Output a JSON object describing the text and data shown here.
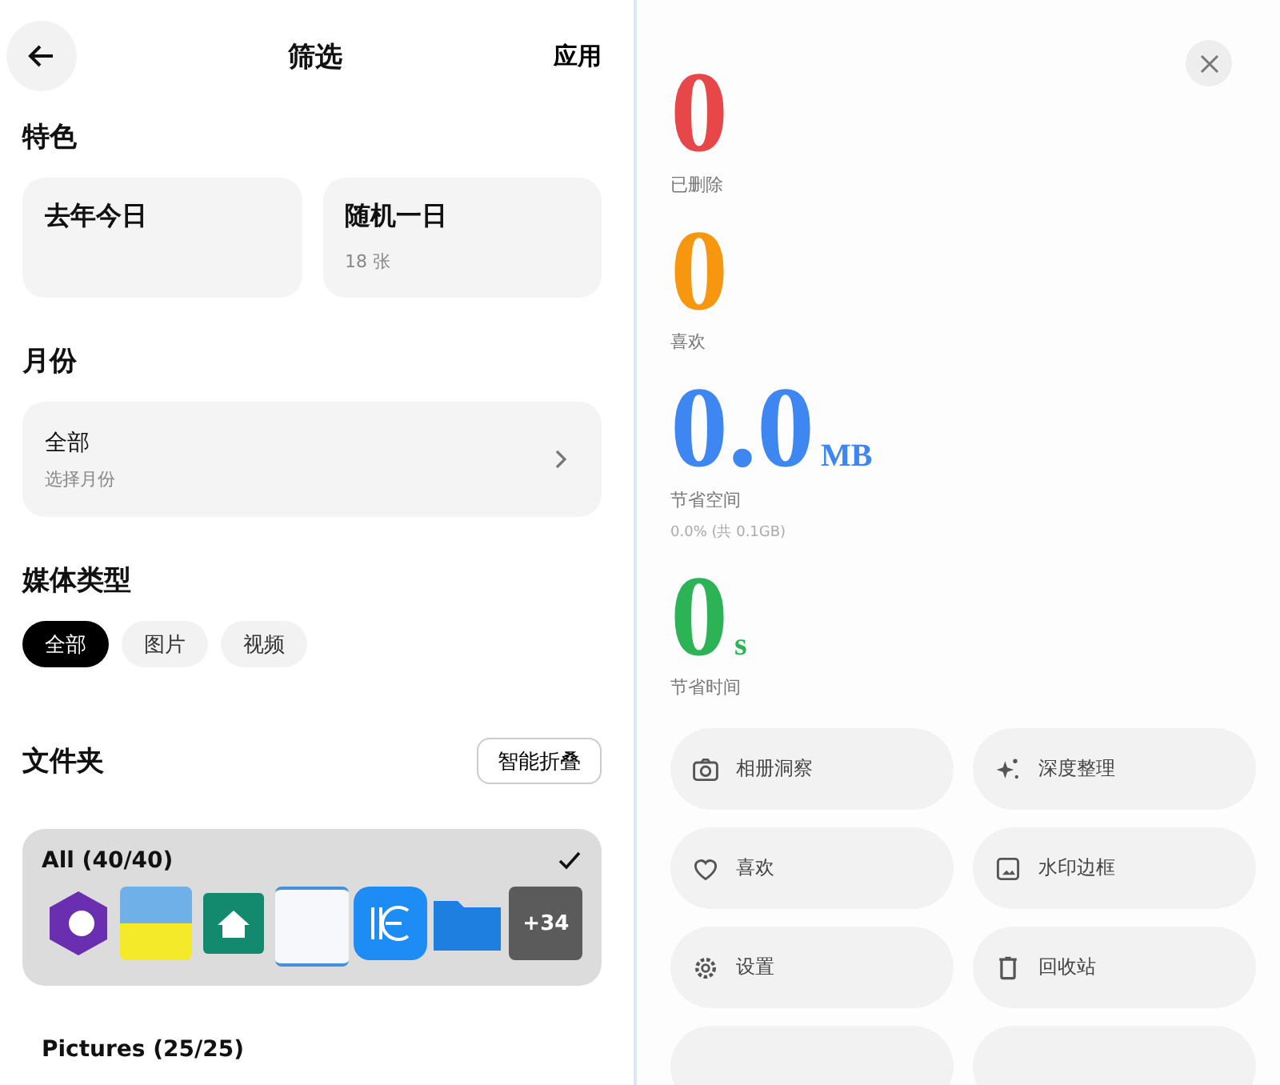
{
  "header": {
    "title": "筛选",
    "action": "应用"
  },
  "featured": {
    "heading": "特色",
    "cards": [
      {
        "title": "去年今日"
      },
      {
        "title": "随机一日",
        "subtitle": "18 张"
      }
    ]
  },
  "month": {
    "heading": "月份",
    "value": "全部",
    "hint": "选择月份"
  },
  "media": {
    "heading": "媒体类型",
    "chips": [
      {
        "label": "全部",
        "selected": true
      },
      {
        "label": "图片",
        "selected": false
      },
      {
        "label": "视频",
        "selected": false
      }
    ]
  },
  "folders": {
    "heading": "文件夹",
    "fold_button": "智能折叠",
    "items": [
      {
        "name": "All (40/40)",
        "selected": true,
        "thumbnails": [
          {
            "kind": "hexagon"
          },
          {
            "kind": "banner"
          },
          {
            "kind": "house"
          },
          {
            "kind": "document"
          },
          {
            "kind": "app"
          },
          {
            "kind": "folder"
          },
          {
            "kind": "more",
            "label": "+34"
          }
        ]
      },
      {
        "name": "Pictures (25/25)",
        "selected": false
      }
    ]
  },
  "stats": [
    {
      "value": "0",
      "label": "已删除",
      "color": "#e8474a"
    },
    {
      "value": "0",
      "label": "喜欢",
      "color": "#f7970f"
    },
    {
      "value": "0.0",
      "unit": "MB",
      "label": "节省空间",
      "note": "0.0% (共 0.1GB)",
      "color": "#3e86f2"
    },
    {
      "value": "0",
      "unit": "s",
      "label": "节省时间",
      "color": "#2cb356"
    }
  ],
  "actions": [
    {
      "kind": "camera",
      "label": "相册洞察"
    },
    {
      "kind": "sparkle",
      "label": "深度整理"
    },
    {
      "kind": "heart",
      "label": "喜欢"
    },
    {
      "kind": "image",
      "label": "水印边框"
    },
    {
      "kind": "gear",
      "label": "设置"
    },
    {
      "kind": "trash",
      "label": "回收站"
    },
    {
      "kind": "partial"
    },
    {
      "kind": "partial"
    }
  ]
}
